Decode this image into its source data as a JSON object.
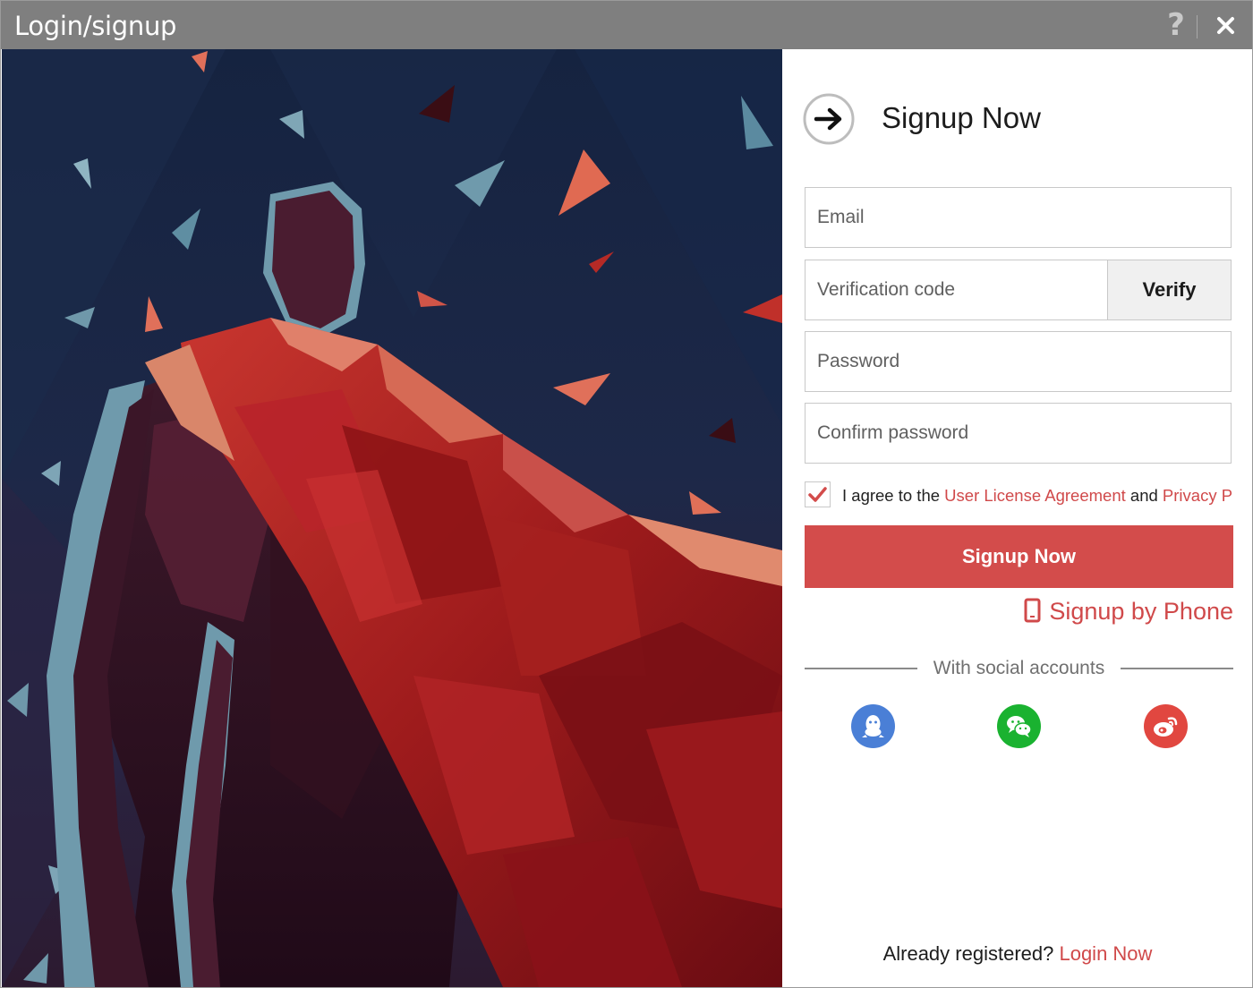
{
  "window": {
    "title": "Login/signup",
    "help_label": "?"
  },
  "heading": {
    "title": "Signup Now",
    "icon": "arrow-right-circle-icon"
  },
  "form": {
    "email_placeholder": "Email",
    "code_placeholder": "Verification code",
    "verify_label": "Verify",
    "password_placeholder": "Password",
    "confirm_placeholder": "Confirm password"
  },
  "agreement": {
    "checked": true,
    "prefix": "I agree to the ",
    "license_link": "User License Agreement",
    "conjunction": " and ",
    "privacy_link": "Privacy P"
  },
  "submit_label": "Signup Now",
  "phone_link": {
    "label": "Signup by Phone",
    "icon": "mobile-phone-icon"
  },
  "social": {
    "label": "With social accounts",
    "accounts": [
      {
        "name": "qq",
        "icon": "qq-penguin-icon",
        "color": "#4a7fd6"
      },
      {
        "name": "wechat",
        "icon": "wechat-icon",
        "color": "#1ab230"
      },
      {
        "name": "weibo",
        "icon": "weibo-icon",
        "color": "#e14740"
      }
    ]
  },
  "footer": {
    "prompt": "Already registered? ",
    "link": "Login Now"
  },
  "colors": {
    "accent": "#d34c4b",
    "titlebar": "#7f7f7f",
    "link": "#d0494a"
  }
}
